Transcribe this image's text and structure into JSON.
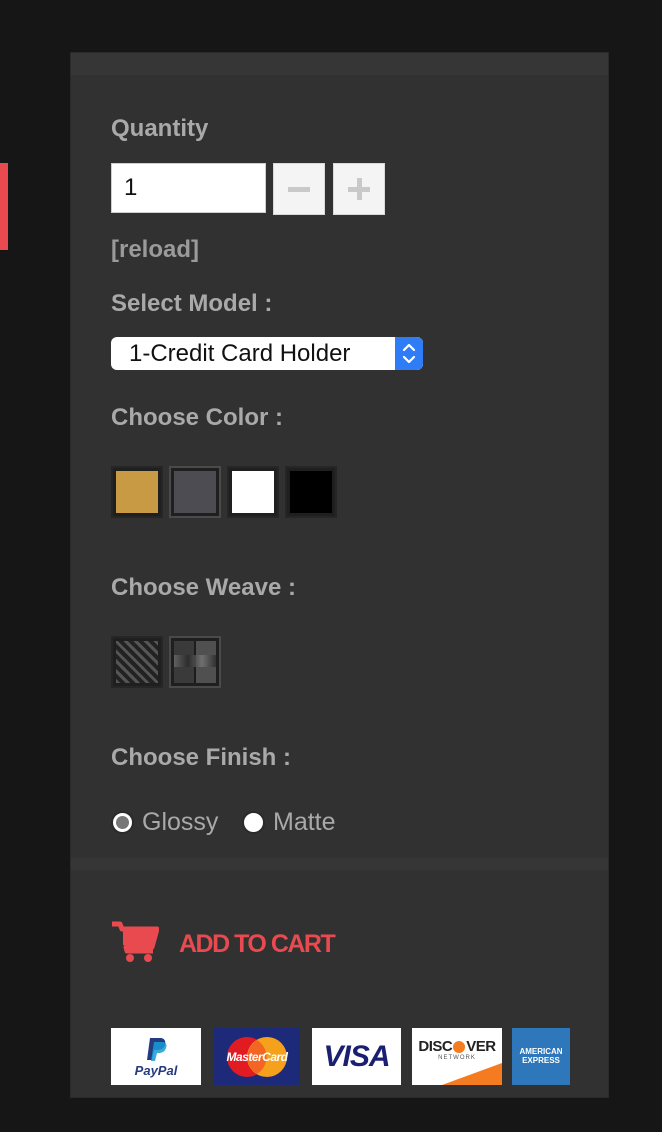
{
  "quantity": {
    "label": "Quantity",
    "value": "1",
    "reload_label": "[reload]"
  },
  "model": {
    "label": "Select Model :",
    "selected": "1-Credit Card Holder"
  },
  "color": {
    "label": "Choose Color :",
    "swatches": [
      {
        "name": "gold",
        "hex": "#c89a44"
      },
      {
        "name": "gray",
        "hex": "#4c4c52"
      },
      {
        "name": "white",
        "hex": "#ffffff"
      },
      {
        "name": "black",
        "hex": "#000000"
      }
    ],
    "selected_index": 1
  },
  "weave": {
    "label": "Choose Weave :",
    "options": [
      "weave-pattern-a",
      "weave-pattern-b"
    ],
    "selected_index": 1
  },
  "finish": {
    "label": "Choose Finish :",
    "options": [
      {
        "label": "Glossy",
        "checked": true
      },
      {
        "label": "Matte",
        "checked": false
      }
    ]
  },
  "cart": {
    "label": "ADD TO CART",
    "icon": "shopping-cart-icon"
  },
  "payments": {
    "paypal": "PayPal",
    "mastercard": "MasterCard",
    "visa": "VISA",
    "discover_a": "DISC",
    "discover_b": "VER",
    "discover_network": "NETWORK",
    "amex_1": "AMERICAN",
    "amex_2": "EXPRESS"
  },
  "colors": {
    "page_bg": "#161616",
    "panel_bg": "#313131",
    "label_text": "#a9a9a9",
    "accent_red": "#e84a4f",
    "select_blue": "#2f7df6"
  }
}
